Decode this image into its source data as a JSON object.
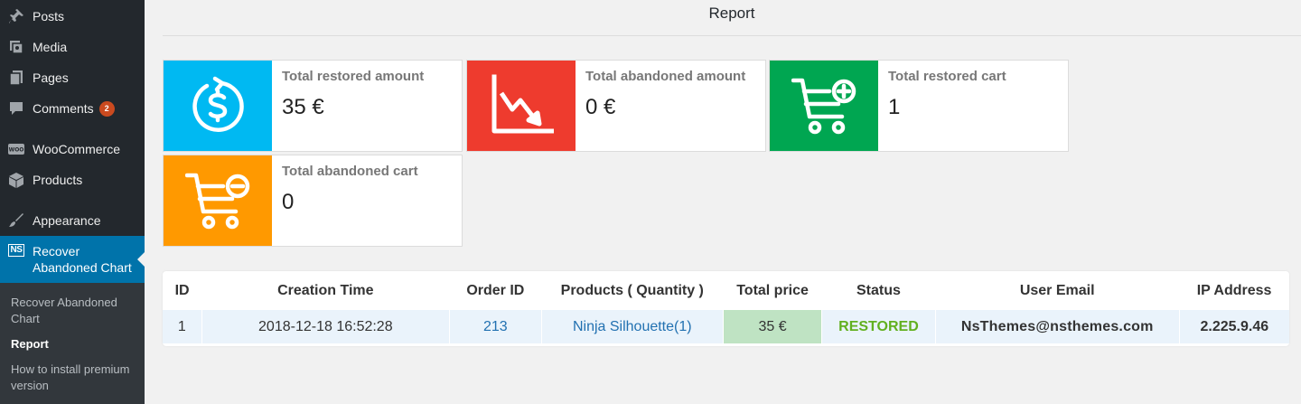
{
  "sidebar": {
    "items": [
      {
        "label": "Posts",
        "icon": "pin-icon"
      },
      {
        "label": "Media",
        "icon": "media-icon"
      },
      {
        "label": "Pages",
        "icon": "pages-icon"
      },
      {
        "label": "Comments",
        "icon": "comment-icon",
        "badge": "2"
      },
      {
        "label": "WooCommerce",
        "icon": "woocommerce-icon"
      },
      {
        "label": "Products",
        "icon": "box-icon"
      },
      {
        "label": "Appearance",
        "icon": "brush-icon"
      }
    ],
    "active": {
      "label_line1": "Recover",
      "label_line2": "Abandoned Chart",
      "logo": "NS"
    },
    "submenu": [
      {
        "label": "Recover Abandoned Chart"
      },
      {
        "label": "Report"
      },
      {
        "label": "How to install premium version"
      }
    ]
  },
  "page": {
    "title": "Report"
  },
  "cards": [
    {
      "label": "Total restored amount",
      "value": "35 €",
      "icon": "dollar-refresh-icon",
      "color": "#00b9f2"
    },
    {
      "label": "Total abandoned amount",
      "value": "0 €",
      "icon": "chart-down-icon",
      "color": "#ee3b2e"
    },
    {
      "label": "Total restored cart",
      "value": "1",
      "icon": "cart-plus-icon",
      "color": "#00a651"
    },
    {
      "label": "Total abandoned cart",
      "value": "0",
      "icon": "cart-minus-icon",
      "color": "#ff9900"
    }
  ],
  "table": {
    "headers": [
      "ID",
      "Creation Time",
      "Order ID",
      "Products ( Quantity )",
      "Total price",
      "Status",
      "User Email",
      "IP Address"
    ],
    "rows": [
      {
        "id": "1",
        "time": "2018-12-18 16:52:28",
        "order": "213",
        "products": "Ninja Silhouette(1)",
        "price": "35 €",
        "status": "RESTORED",
        "email": "NsThemes@nsthemes.com",
        "ip": "2.225.9.46"
      }
    ]
  },
  "colors": {
    "sidebar": "#23282d",
    "active": "#0073aa",
    "restored": "#61b01f",
    "link": "#2271b1"
  }
}
